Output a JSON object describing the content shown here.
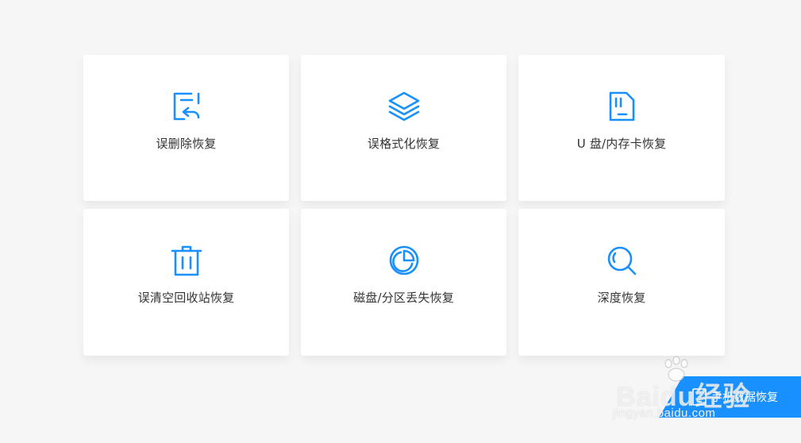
{
  "accent_color": "#1890ff",
  "cards": [
    {
      "label": "误删除恢复",
      "icon": "file-restore-icon"
    },
    {
      "label": "误格式化恢复",
      "icon": "layers-icon"
    },
    {
      "label": "U 盘/内存卡恢复",
      "icon": "sd-card-icon"
    },
    {
      "label": "误清空回收站恢复",
      "icon": "trash-icon"
    },
    {
      "label": "磁盘/分区丢失恢复",
      "icon": "pie-chart-icon"
    },
    {
      "label": "深度恢复",
      "icon": "search-icon"
    }
  ],
  "phone_recovery": {
    "label": "手机数据恢复",
    "icon": "phone-icon"
  },
  "watermark": {
    "text": "Baidu经验",
    "sub": "jingyan.baidu.com"
  }
}
